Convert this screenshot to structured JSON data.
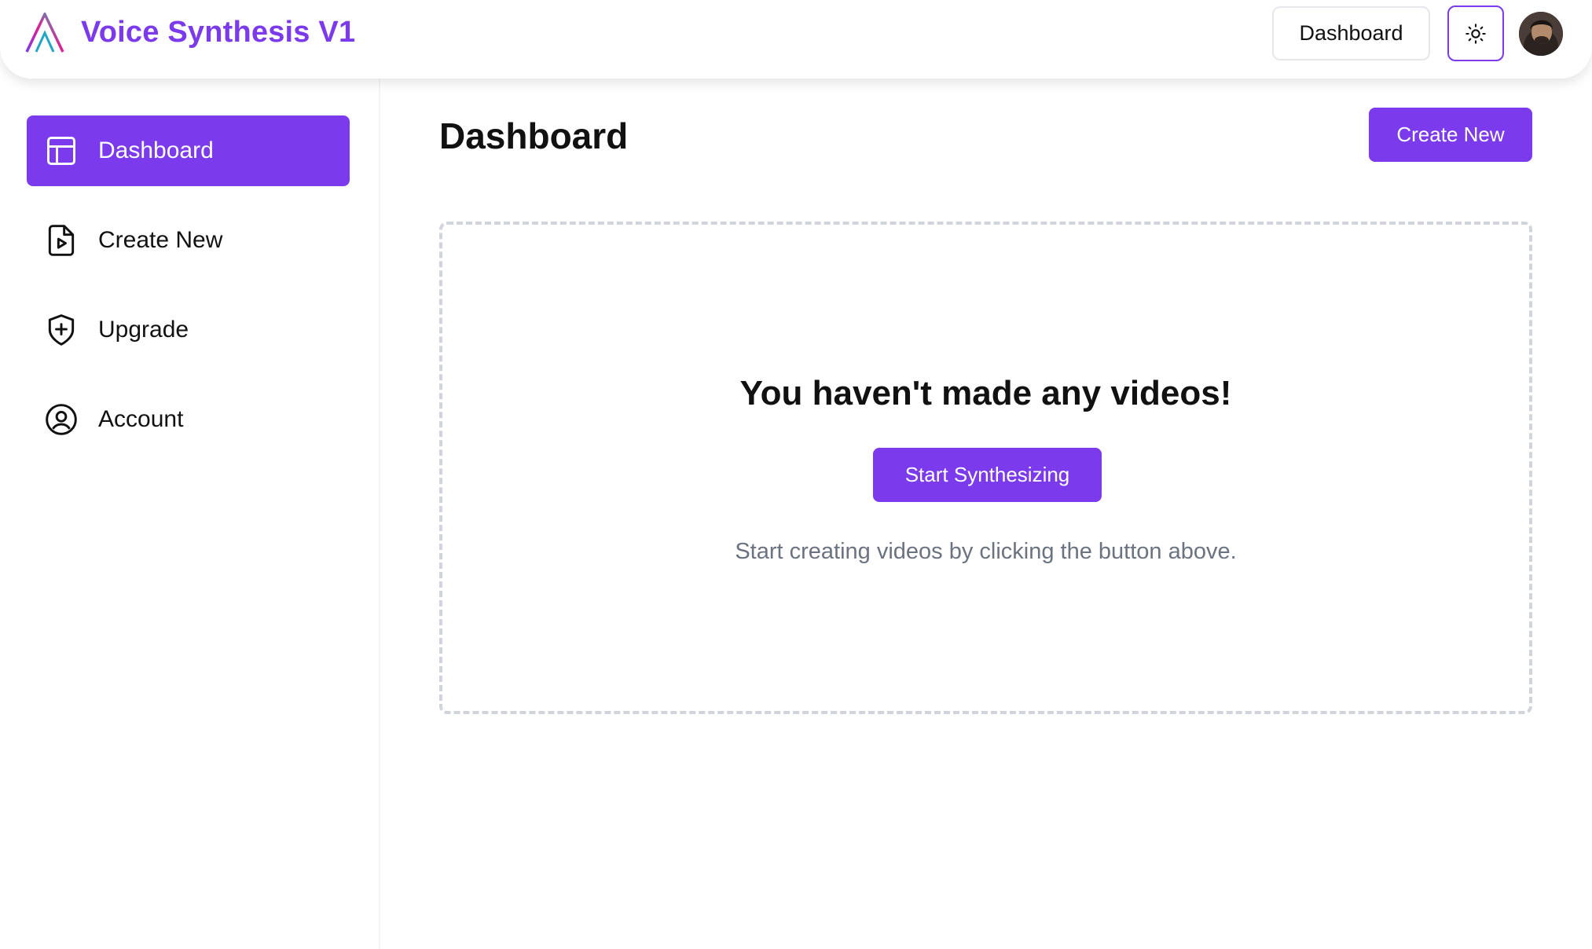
{
  "header": {
    "app_title": "Voice Synthesis V1",
    "dashboard_button": "Dashboard",
    "theme_icon": "sun-icon",
    "avatar": "user-avatar"
  },
  "sidebar": {
    "items": [
      {
        "label": "Dashboard",
        "icon": "layout-icon",
        "active": true
      },
      {
        "label": "Create New",
        "icon": "file-video-icon",
        "active": false
      },
      {
        "label": "Upgrade",
        "icon": "shield-plus-icon",
        "active": false
      },
      {
        "label": "Account",
        "icon": "user-circle-icon",
        "active": false
      }
    ]
  },
  "main": {
    "title": "Dashboard",
    "create_button": "Create New",
    "empty_state": {
      "title": "You haven't made any videos!",
      "button": "Start Synthesizing",
      "description": "Start creating videos by clicking the button above."
    }
  },
  "colors": {
    "accent": "#7c3aed",
    "muted_text": "#6b7280",
    "border": "#d1d5db"
  }
}
